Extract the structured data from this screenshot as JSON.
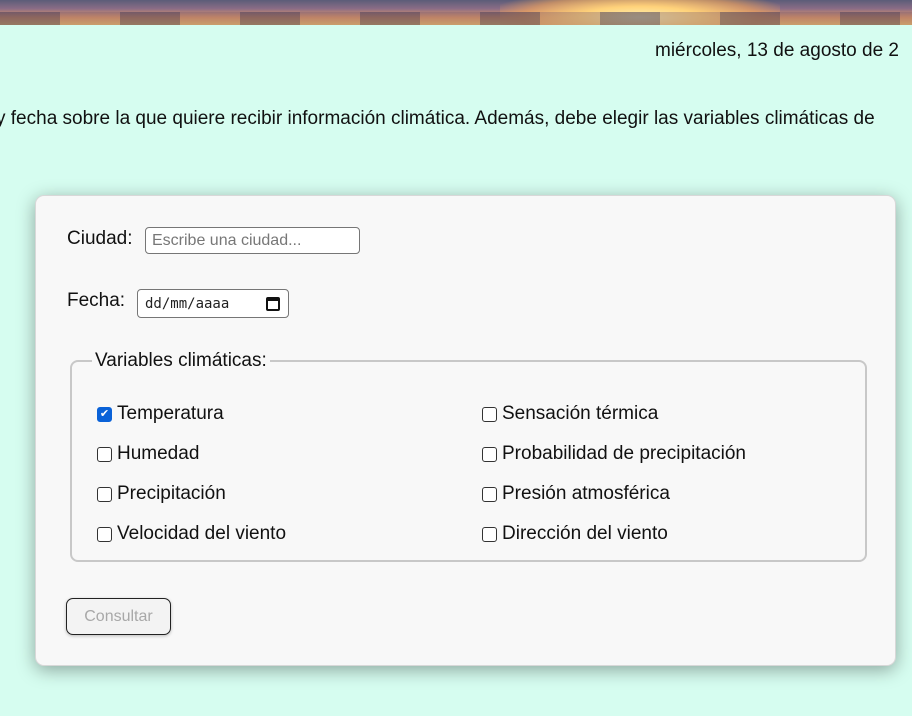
{
  "header": {
    "date_text": "miércoles, 13 de agosto de 2",
    "intro_text": "y fecha sobre la que quiere recibir información climática. Además, debe elegir las variables climáticas de"
  },
  "form": {
    "city_label": "Ciudad:",
    "city_placeholder": "Escribe una ciudad...",
    "city_value": "",
    "date_label": "Fecha:",
    "date_placeholder": "dd/mm/aaaa",
    "variables_legend": "Variables climáticas:",
    "variables": [
      {
        "label": "Temperatura",
        "checked": true
      },
      {
        "label": "Sensación térmica",
        "checked": false
      },
      {
        "label": "Humedad",
        "checked": false
      },
      {
        "label": "Probabilidad de precipitación",
        "checked": false
      },
      {
        "label": "Precipitación",
        "checked": false
      },
      {
        "label": "Presión atmosférica",
        "checked": false
      },
      {
        "label": "Velocidad del viento",
        "checked": false
      },
      {
        "label": "Dirección del viento",
        "checked": false
      }
    ],
    "submit_label": "Consultar",
    "submit_disabled": true
  },
  "colors": {
    "page_background": "#d6fdf0",
    "card_background": "#f8f8f8",
    "checkbox_checked": "#0a62d8"
  },
  "icons": {
    "date_picker": "calendar-icon",
    "checkbox_check": "checkmark-icon"
  }
}
